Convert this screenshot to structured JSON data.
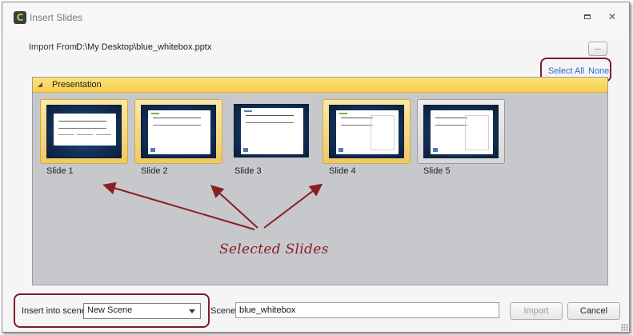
{
  "window": {
    "title": "Insert Slides",
    "icons": {
      "app": "captivate-app-icon",
      "restore": "restore-icon",
      "close": "close-icon"
    }
  },
  "import": {
    "label": "Import From:",
    "path": "D:\\My Desktop\\blue_whitebox.pptx",
    "browse_label": "..."
  },
  "selection": {
    "select_all": "Select All",
    "none": "None"
  },
  "panel": {
    "title": "Presentation"
  },
  "slides": [
    {
      "label": "Slide 1",
      "selected": true
    },
    {
      "label": "Slide 2",
      "selected": true
    },
    {
      "label": "Slide 3",
      "selected": false
    },
    {
      "label": "Slide 4",
      "selected": true
    },
    {
      "label": "Slide 5",
      "selected": false
    }
  ],
  "annotation": {
    "text": "Selected Slides",
    "color": "#8a1f24"
  },
  "footer": {
    "insert_label": "Insert into scene:",
    "insert_value": "New Scene",
    "scene_label": "Scene:",
    "scene_value": "blue_whitebox",
    "import_button": "Import",
    "cancel_button": "Cancel"
  },
  "colors": {
    "selected_border": "#d2a93c",
    "header_yellow": "#f6cf4d",
    "callout_border": "#7a1f2a",
    "link_blue": "#2a6ad0"
  }
}
